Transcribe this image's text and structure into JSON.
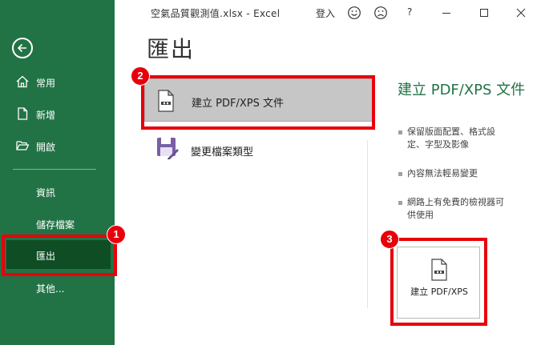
{
  "window": {
    "doc_title": "空氣品質觀測值.xlsx  -  Excel",
    "signin": "登入",
    "help": "?",
    "icons": [
      "smile-icon",
      "frown-icon",
      "help-icon",
      "minimize-icon",
      "maximize-icon",
      "close-icon"
    ]
  },
  "sidebar": {
    "items": [
      {
        "label": "常用",
        "icon": "home-icon"
      },
      {
        "label": "新增",
        "icon": "new-file-icon"
      },
      {
        "label": "開啟",
        "icon": "open-folder-icon"
      },
      {
        "label": "資訊"
      },
      {
        "label": "儲存檔案"
      },
      {
        "label": "匯出",
        "active": true
      },
      {
        "label": "其他..."
      }
    ]
  },
  "main": {
    "title": "匯出",
    "options": [
      {
        "label": "建立 PDF/XPS 文件",
        "icon": "pdf-document-icon",
        "selected": true
      },
      {
        "label": "變更檔案類型",
        "icon": "floppy-edit-icon"
      }
    ]
  },
  "panel": {
    "title": "建立 PDF/XPS 文件",
    "bullets": [
      "保留版面配置、格式設定、字型及影像",
      "內容無法輕易變更",
      "網路上有免費的檢視器可供使用"
    ],
    "button_label": "建立 PDF/XPS"
  },
  "annotations": {
    "badges": [
      "1",
      "2",
      "3"
    ],
    "color": "#e8000b"
  },
  "colors": {
    "accent": "#217346",
    "active_nav": "#0f4d25",
    "selected_option": "#c6c6c6"
  }
}
